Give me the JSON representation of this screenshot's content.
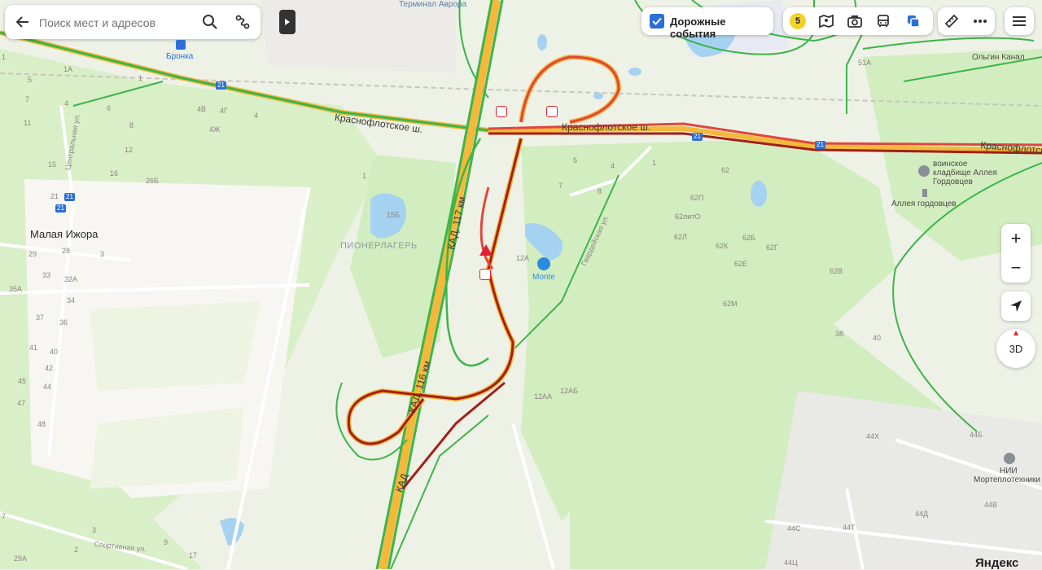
{
  "search": {
    "placeholder": "Поиск мест и адресов"
  },
  "toolbar": {
    "traffic_label": "Дорожные события",
    "traffic_checked": true,
    "traffic_score": "5",
    "icons": [
      "panorama-icon",
      "camera-icon",
      "transit-icon",
      "layers-icon",
      "ruler-icon",
      "more-icon",
      "menu-icon"
    ]
  },
  "controls": {
    "zoom_in": "+",
    "zoom_out": "−",
    "view_3d": "3D"
  },
  "labels": {
    "terminal": "Терминал Аврора",
    "bronka": "Бронка",
    "olgin_kanal": "Ольгин Канал",
    "krasnoflotskoe_1": "Краснофлотское ш.",
    "krasnoflotskoe_2": "Краснофлотское ш.",
    "krasnoflotskoe_3": "Краснофлотск",
    "kad_117": "КАД, 117 км",
    "kad_116": "КАД, 116 км",
    "kad": "КАД",
    "malaya_izhora": "Малая Ижора",
    "pionerlager": "ПИОНЕРЛАГЕРЬ",
    "monte": "Monte",
    "cemetery": "воинское кладбище Аллея Гордовцев",
    "cemetery_line1": "воинское",
    "cemetery_line2": "кладбище Аллея",
    "cemetery_line3": "Гордовцев",
    "alleya": "Аллея гордовцев",
    "nii_line1": "НИИ",
    "nii_line2": "Мортеплотехники",
    "centralnaya": "Центральная ул.",
    "gvardeyskaya": "Гвардейская ул.",
    "sportivnaya": "Спортивная ул.",
    "yandex": "Яндекс",
    "route_21a": "21",
    "route_21b": "21",
    "route_21c": "21",
    "route_21d": "21",
    "route_21e": "21"
  },
  "house_numbers": {
    "n1": "1",
    "n2": "5",
    "n3": "1А",
    "n4": "7",
    "n5": "11",
    "n6": "4",
    "n7": "6",
    "n8": "8",
    "n9": "12",
    "n10": "15",
    "n11": "16",
    "n12": "26Б",
    "n13": "21",
    "n14": "29",
    "n15": "28",
    "n16": "3",
    "n17": "33",
    "n18": "32А",
    "n19": "35А",
    "n20": "34",
    "n21": "37",
    "n22": "36",
    "n23": "41",
    "n24": "40",
    "n25": "42",
    "n26": "45",
    "n27": "44",
    "n28": "47",
    "n29": "48",
    "n30": "4В",
    "n31": "4Г",
    "n32": "4",
    "n33": "4Ж",
    "n34": "1",
    "n35": "15Б",
    "n36": "12А",
    "n37": "5",
    "n38": "4",
    "n39": "1",
    "n40": "7",
    "n41": "8",
    "n42": "62",
    "n43": "62П",
    "n44": "62литО",
    "n45": "62Л",
    "n46": "62К",
    "n47": "62Б",
    "n48": "62Г",
    "n49": "62Е",
    "n50": "62В",
    "n51": "62М",
    "n52": "38",
    "n53": "40",
    "n54": "12АА",
    "n55": "12АБ",
    "n56": "44Х",
    "n57": "44Б",
    "n58": "44В",
    "n59": "44Д",
    "n60": "44С",
    "n61": "44Т",
    "n62": "44Ц",
    "n63": "51А",
    "n64": "3",
    "n65": "9",
    "n66": "2",
    "n67": "17",
    "n68": "29А",
    "n69": "7",
    "n70": "1"
  },
  "colors": {
    "jam": "#e0463c",
    "heavy_jam": "#a31f17",
    "free": "#3cb54a",
    "road": "#f4b93b"
  }
}
